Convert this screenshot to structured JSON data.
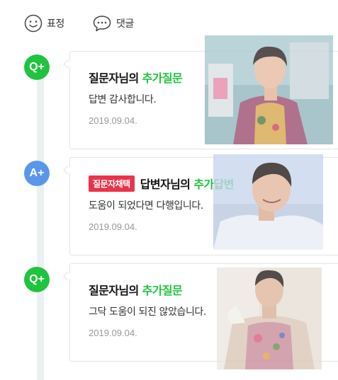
{
  "actions": {
    "emotion_label": "표정",
    "comment_label": "댓글"
  },
  "entries": [
    {
      "badge": "Q+",
      "tag": "",
      "title_prefix": "질문자님의 ",
      "title_emphasis": "추가질문",
      "body": "답변 감사합니다.",
      "date": "2019.09.04."
    },
    {
      "badge": "A+",
      "tag": "질문자채택",
      "title_prefix": "답변자님의 ",
      "title_emphasis": "추가답변",
      "body": "도움이 되었다면 다행입니다.",
      "date": "2019.09.04."
    },
    {
      "badge": "Q+",
      "tag": "",
      "title_prefix": "질문자님의 ",
      "title_emphasis": "추가질문",
      "body": "그닥 도움이 되진 않았습니다.",
      "date": "2019.09.04."
    }
  ],
  "colors": {
    "question_badge": "#1fc43e",
    "answer_badge": "#5a97ea",
    "selected_tag": "#e8344a",
    "timeline": "#eaf1f0"
  },
  "icons": [
    "smiley-icon",
    "speech-bubble-icon"
  ]
}
